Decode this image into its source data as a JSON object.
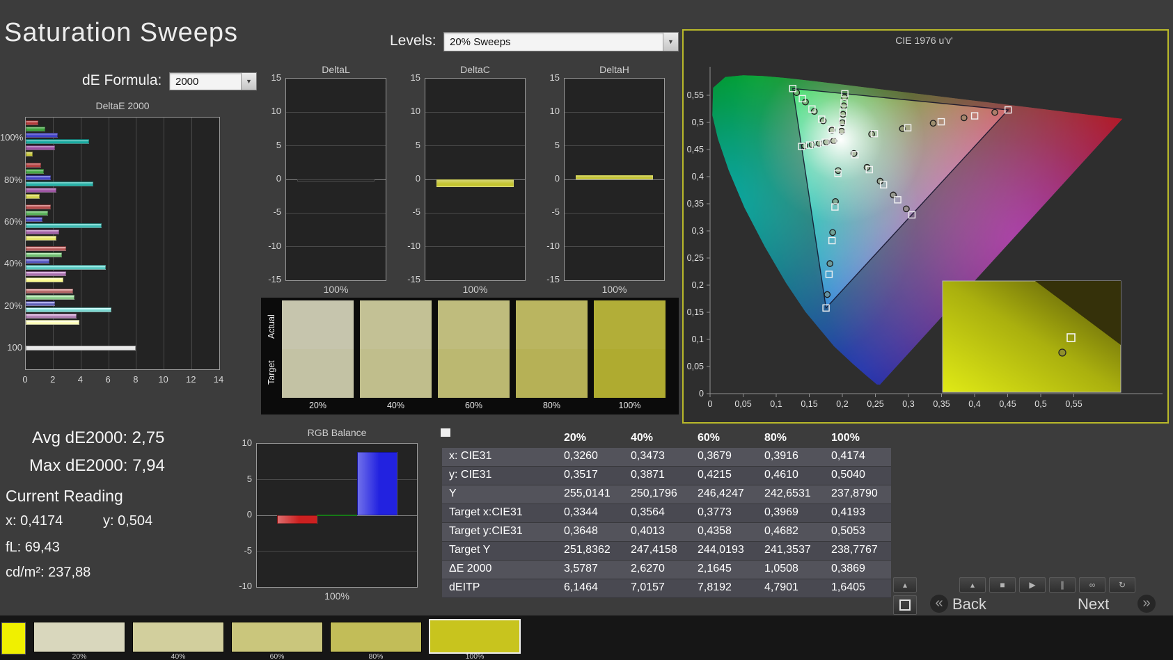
{
  "page": {
    "title": "Saturation Sweeps",
    "de_formula_label": "dE Formula:",
    "de_formula_value": "2000",
    "levels_label": "Levels:",
    "levels_value": "20% Sweeps"
  },
  "stats": {
    "avg_de": "Avg dE2000: 2,75",
    "max_de": "Max dE2000: 7,94",
    "current_reading": "Current Reading",
    "x": "x: 0,4174",
    "y": "y: 0,504",
    "fl": "fL: 69,43",
    "cdm2": "cd/m²: 237,88"
  },
  "chart_data": [
    {
      "id": "deltae",
      "type": "bar",
      "orientation": "horizontal",
      "title": "DeltaE 2000",
      "categories": [
        "100%",
        "80%",
        "60%",
        "40%",
        "20%",
        "100"
      ],
      "xlim": [
        0,
        14
      ],
      "xticks": [
        0,
        2,
        4,
        6,
        8,
        10,
        12,
        14
      ],
      "series": [
        {
          "name": "red",
          "color": "#b43a3a",
          "values": [
            0.9,
            1.1,
            1.8,
            2.9,
            3.4,
            null
          ]
        },
        {
          "name": "green",
          "color": "#3aa03a",
          "values": [
            1.4,
            1.3,
            1.6,
            2.6,
            3.5,
            null
          ]
        },
        {
          "name": "blue",
          "color": "#4040c8",
          "values": [
            2.3,
            1.8,
            1.2,
            1.7,
            2.1,
            null
          ]
        },
        {
          "name": "cyan",
          "color": "#18aaa0",
          "values": [
            4.6,
            4.9,
            5.5,
            5.8,
            6.2,
            null
          ]
        },
        {
          "name": "magenta",
          "color": "#9a4fa0",
          "values": [
            2.1,
            2.2,
            2.4,
            2.9,
            3.7,
            null
          ]
        },
        {
          "name": "yellow",
          "color": "#c8c83c",
          "values": [
            0.5,
            1.0,
            2.2,
            2.7,
            3.9,
            null
          ]
        },
        {
          "name": "white",
          "color": "#e6e6e6",
          "values": [
            null,
            null,
            null,
            null,
            null,
            7.94
          ]
        }
      ]
    },
    {
      "id": "deltaL",
      "type": "bar",
      "title": "DeltaL",
      "categories": [
        "100%"
      ],
      "ylim": [
        -15,
        15
      ],
      "yticks": [
        15,
        10,
        5,
        0,
        -5,
        -10,
        -15
      ],
      "values": [
        -0.3
      ],
      "color": "#101010"
    },
    {
      "id": "deltaC",
      "type": "bar",
      "title": "DeltaC",
      "categories": [
        "100%"
      ],
      "ylim": [
        -15,
        15
      ],
      "yticks": [
        15,
        10,
        5,
        0,
        -5,
        -10,
        -15
      ],
      "values": [
        -1.1
      ],
      "color": "#c4c432"
    },
    {
      "id": "deltaH",
      "type": "bar",
      "title": "DeltaH",
      "categories": [
        "100%"
      ],
      "ylim": [
        -15,
        15
      ],
      "yticks": [
        15,
        10,
        5,
        0,
        -5,
        -10,
        -15
      ],
      "values": [
        0.6
      ],
      "color": "#c4c432"
    },
    {
      "id": "rgb",
      "type": "bar",
      "title": "RGB Balance",
      "categories": [
        "100%"
      ],
      "ylim": [
        -10,
        10
      ],
      "yticks": [
        10,
        5,
        0,
        -5,
        -10
      ],
      "series": [
        {
          "name": "red",
          "color": "#cc2020",
          "value": -1.2
        },
        {
          "name": "green",
          "color": "#22bb22",
          "value": 0
        },
        {
          "name": "blue",
          "color": "#2222e0",
          "value": 8.8
        }
      ]
    },
    {
      "id": "cie",
      "type": "scatter",
      "title": "CIE 1976 u'v'",
      "tick_step": 0.05,
      "xtick_labels": [
        "0",
        "0,05",
        "0,1",
        "0,15",
        "0,2",
        "0,25",
        "0,3",
        "0,35",
        "0,4",
        "0,45",
        "0,5",
        "0,55"
      ],
      "ytick_labels": [
        "0",
        "0,05",
        "0,1",
        "0,15",
        "0,2",
        "0,25",
        "0,3",
        "0,35",
        "0,4",
        "0,45",
        "0,5",
        "0,55"
      ],
      "targets": [
        [
          0.2484,
          0.4792
        ],
        [
          0.299,
          0.4901
        ],
        [
          0.3495,
          0.5011
        ],
        [
          0.4001,
          0.512
        ],
        [
          0.4507,
          0.5229
        ],
        [
          0.1832,
          0.4871
        ],
        [
          0.1687,
          0.506
        ],
        [
          0.1541,
          0.5248
        ],
        [
          0.1396,
          0.5437
        ],
        [
          0.125,
          0.5625
        ],
        [
          0.1933,
          0.4062
        ],
        [
          0.1888,
          0.3441
        ],
        [
          0.1844,
          0.2821
        ],
        [
          0.1799,
          0.22
        ],
        [
          0.1754,
          0.1579
        ],
        [
          0.1859,
          0.4658
        ],
        [
          0.1741,
          0.4633
        ],
        [
          0.1622,
          0.4607
        ],
        [
          0.1504,
          0.4582
        ],
        [
          0.1385,
          0.4557
        ],
        [
          0.2193,
          0.4405
        ],
        [
          0.2408,
          0.4128
        ],
        [
          0.2623,
          0.385
        ],
        [
          0.2838,
          0.3573
        ],
        [
          0.3053,
          0.3295
        ],
        [
          0.199,
          0.4852
        ],
        [
          0.2002,
          0.5021
        ],
        [
          0.2014,
          0.519
        ],
        [
          0.2026,
          0.5359
        ],
        [
          0.2038,
          0.5528
        ]
      ],
      "measurements": [
        [
          0.2443,
          0.4783
        ],
        [
          0.2909,
          0.4884
        ],
        [
          0.3374,
          0.4984
        ],
        [
          0.384,
          0.5085
        ],
        [
          0.4305,
          0.5185
        ],
        [
          0.1844,
          0.4856
        ],
        [
          0.171,
          0.503
        ],
        [
          0.1576,
          0.5203
        ],
        [
          0.1442,
          0.5376
        ],
        [
          0.1308,
          0.555
        ],
        [
          0.1937,
          0.4112
        ],
        [
          0.1896,
          0.3541
        ],
        [
          0.1854,
          0.297
        ],
        [
          0.1813,
          0.2398
        ],
        [
          0.1772,
          0.1827
        ],
        [
          0.1869,
          0.466
        ],
        [
          0.176,
          0.4637
        ],
        [
          0.1651,
          0.4613
        ],
        [
          0.1542,
          0.459
        ],
        [
          0.1432,
          0.4567
        ],
        [
          0.2176,
          0.4428
        ],
        [
          0.2374,
          0.4172
        ],
        [
          0.2572,
          0.3917
        ],
        [
          0.277,
          0.3661
        ],
        [
          0.2967,
          0.3406
        ],
        [
          0.1989,
          0.4838
        ],
        [
          0.2,
          0.4994
        ],
        [
          0.2011,
          0.5149
        ],
        [
          0.2022,
          0.5305
        ],
        [
          0.2033,
          0.5461
        ]
      ]
    }
  ],
  "swatch_panel": {
    "row_labels": [
      "Actual",
      "Target"
    ],
    "items": [
      {
        "label": "20%",
        "actual": "#c6c5ad",
        "target": "#c3c2a4"
      },
      {
        "label": "40%",
        "actual": "#c3c195",
        "target": "#c0be8c"
      },
      {
        "label": "60%",
        "actual": "#bfbc7d",
        "target": "#bbb871"
      },
      {
        "label": "80%",
        "actual": "#bab560",
        "target": "#b6b156"
      },
      {
        "label": "100%",
        "actual": "#b2ae38",
        "target": "#afab30"
      }
    ]
  },
  "table": {
    "headers": [
      "",
      "20%",
      "40%",
      "60%",
      "80%",
      "100%"
    ],
    "rows": [
      {
        "label": "x: CIE31",
        "values": [
          "0,3260",
          "0,3473",
          "0,3679",
          "0,3916",
          "0,4174"
        ]
      },
      {
        "label": "y: CIE31",
        "values": [
          "0,3517",
          "0,3871",
          "0,4215",
          "0,4610",
          "0,5040"
        ]
      },
      {
        "label": "Y",
        "values": [
          "255,0141",
          "250,1796",
          "246,4247",
          "242,6531",
          "237,8790"
        ]
      },
      {
        "label": "Target x:CIE31",
        "values": [
          "0,3344",
          "0,3564",
          "0,3773",
          "0,3969",
          "0,4193"
        ]
      },
      {
        "label": "Target y:CIE31",
        "values": [
          "0,3648",
          "0,4013",
          "0,4358",
          "0,4682",
          "0,5053"
        ]
      },
      {
        "label": "Target Y",
        "values": [
          "251,8362",
          "247,4158",
          "244,0193",
          "241,3537",
          "238,7767"
        ]
      },
      {
        "label": "ΔE 2000",
        "values": [
          "3,5787",
          "2,6270",
          "2,1645",
          "1,0508",
          "0,3869"
        ]
      },
      {
        "label": "dEITP",
        "values": [
          "6,1464",
          "7,0157",
          "7,8192",
          "4,7901",
          "1,6405"
        ]
      }
    ]
  },
  "bottom_bar": {
    "current_color": "#f0f000",
    "swatches": [
      {
        "label": "20%",
        "color": "#d9d7bd",
        "selected": false
      },
      {
        "label": "40%",
        "color": "#d2cf9d",
        "selected": false
      },
      {
        "label": "60%",
        "color": "#cac67c",
        "selected": false
      },
      {
        "label": "80%",
        "color": "#c2bd58",
        "selected": false
      },
      {
        "label": "100%",
        "color": "#c8c41e",
        "selected": true
      }
    ],
    "controls": [
      {
        "name": "measure",
        "icon": "▴"
      },
      {
        "name": "stop",
        "icon": "■"
      },
      {
        "name": "play",
        "icon": "▶"
      },
      {
        "name": "pause",
        "icon": "∥"
      },
      {
        "name": "continuous",
        "icon": "∞"
      },
      {
        "name": "refresh",
        "icon": "↻"
      }
    ],
    "side_buttons": [
      {
        "name": "panel-up",
        "icon": "▴"
      },
      {
        "name": "screen",
        "icon": "■"
      }
    ],
    "back_icon": "«",
    "back_label": "Back",
    "next_label": "Next",
    "next_icon": "»"
  }
}
